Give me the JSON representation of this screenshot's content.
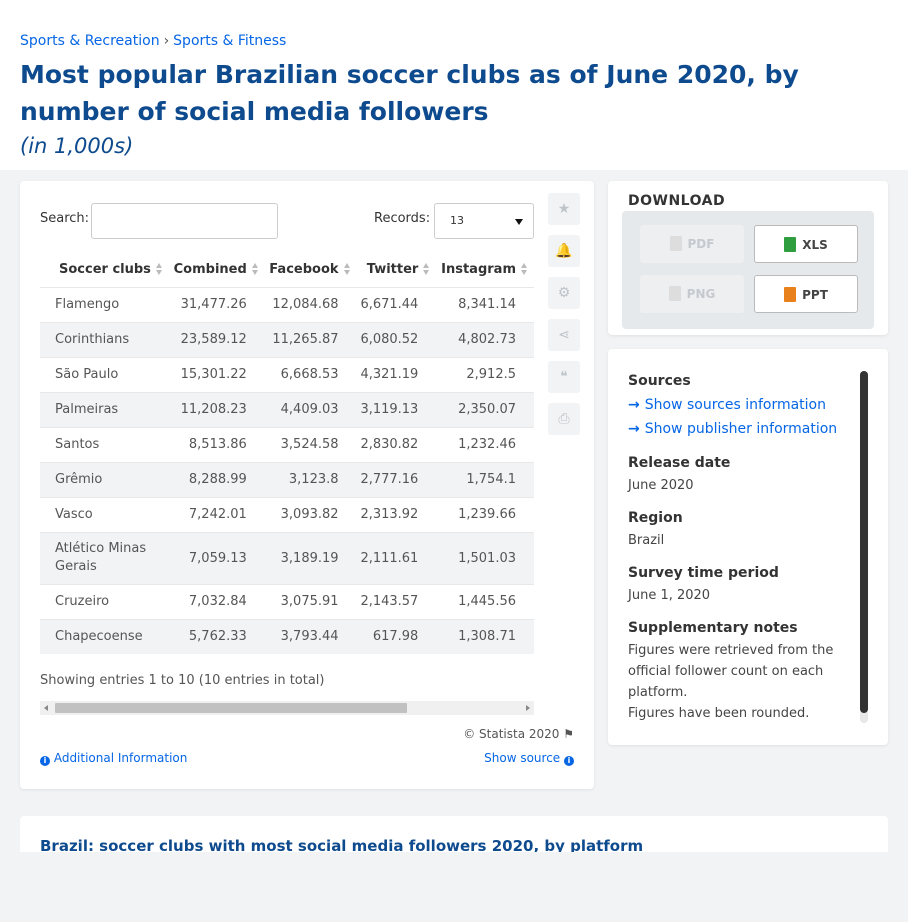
{
  "breadcrumb": [
    "Sports & Recreation",
    "Sports & Fitness"
  ],
  "title": "Most popular Brazilian soccer clubs as of June 2020, by number of social media followers",
  "subtitle": "(in 1,000s)",
  "search": {
    "label": "Search:",
    "value": ""
  },
  "records": {
    "label": "Records:",
    "value": "13"
  },
  "table": {
    "columns": [
      "Soccer clubs",
      "Combined",
      "Facebook",
      "Twitter",
      "Instagram"
    ],
    "rows": [
      [
        "Flamengo",
        "31,477.26",
        "12,084.68",
        "6,671.44",
        "8,341.14"
      ],
      [
        "Corinthians",
        "23,589.12",
        "11,265.87",
        "6,080.52",
        "4,802.73"
      ],
      [
        "São Paulo",
        "15,301.22",
        "6,668.53",
        "4,321.19",
        "2,912.5"
      ],
      [
        "Palmeiras",
        "11,208.23",
        "4,409.03",
        "3,119.13",
        "2,350.07"
      ],
      [
        "Santos",
        "8,513.86",
        "3,524.58",
        "2,830.82",
        "1,232.46"
      ],
      [
        "Grêmio",
        "8,288.99",
        "3,123.8",
        "2,777.16",
        "1,754.1"
      ],
      [
        "Vasco",
        "7,242.01",
        "3,093.82",
        "2,313.92",
        "1,239.66"
      ],
      [
        "Atlético Minas Gerais",
        "7,059.13",
        "3,189.19",
        "2,111.61",
        "1,501.03"
      ],
      [
        "Cruzeiro",
        "7,032.84",
        "3,075.91",
        "2,143.57",
        "1,445.56"
      ],
      [
        "Chapecoense",
        "5,762.33",
        "3,793.44",
        "617.98",
        "1,308.71"
      ]
    ]
  },
  "entries_info": "Showing entries 1 to 10 (10 entries in total)",
  "copyright": "© Statista 2020",
  "additional_info": "Additional Information",
  "show_source": "Show source",
  "download": {
    "title": "DOWNLOAD",
    "pdf": "PDF",
    "xls": "XLS",
    "png": "PNG",
    "ppt": "PPT"
  },
  "sources": {
    "heading": "Sources",
    "show_sources": "Show sources information",
    "show_publisher": "Show publisher information",
    "release_date_label": "Release date",
    "release_date": "June 2020",
    "region_label": "Region",
    "region": "Brazil",
    "survey_label": "Survey time period",
    "survey": "June 1, 2020",
    "notes_label": "Supplementary notes",
    "notes_1": "Figures were retrieved from the official follower count on each platform.",
    "notes_2": "Figures have been rounded."
  },
  "related_title": "Brazil: soccer clubs with most social media followers 2020, by platform",
  "colors": {
    "accent": "#0666e5",
    "title": "#0e4a8e",
    "xls": "#2e9e3e",
    "ppt": "#e8811c"
  }
}
